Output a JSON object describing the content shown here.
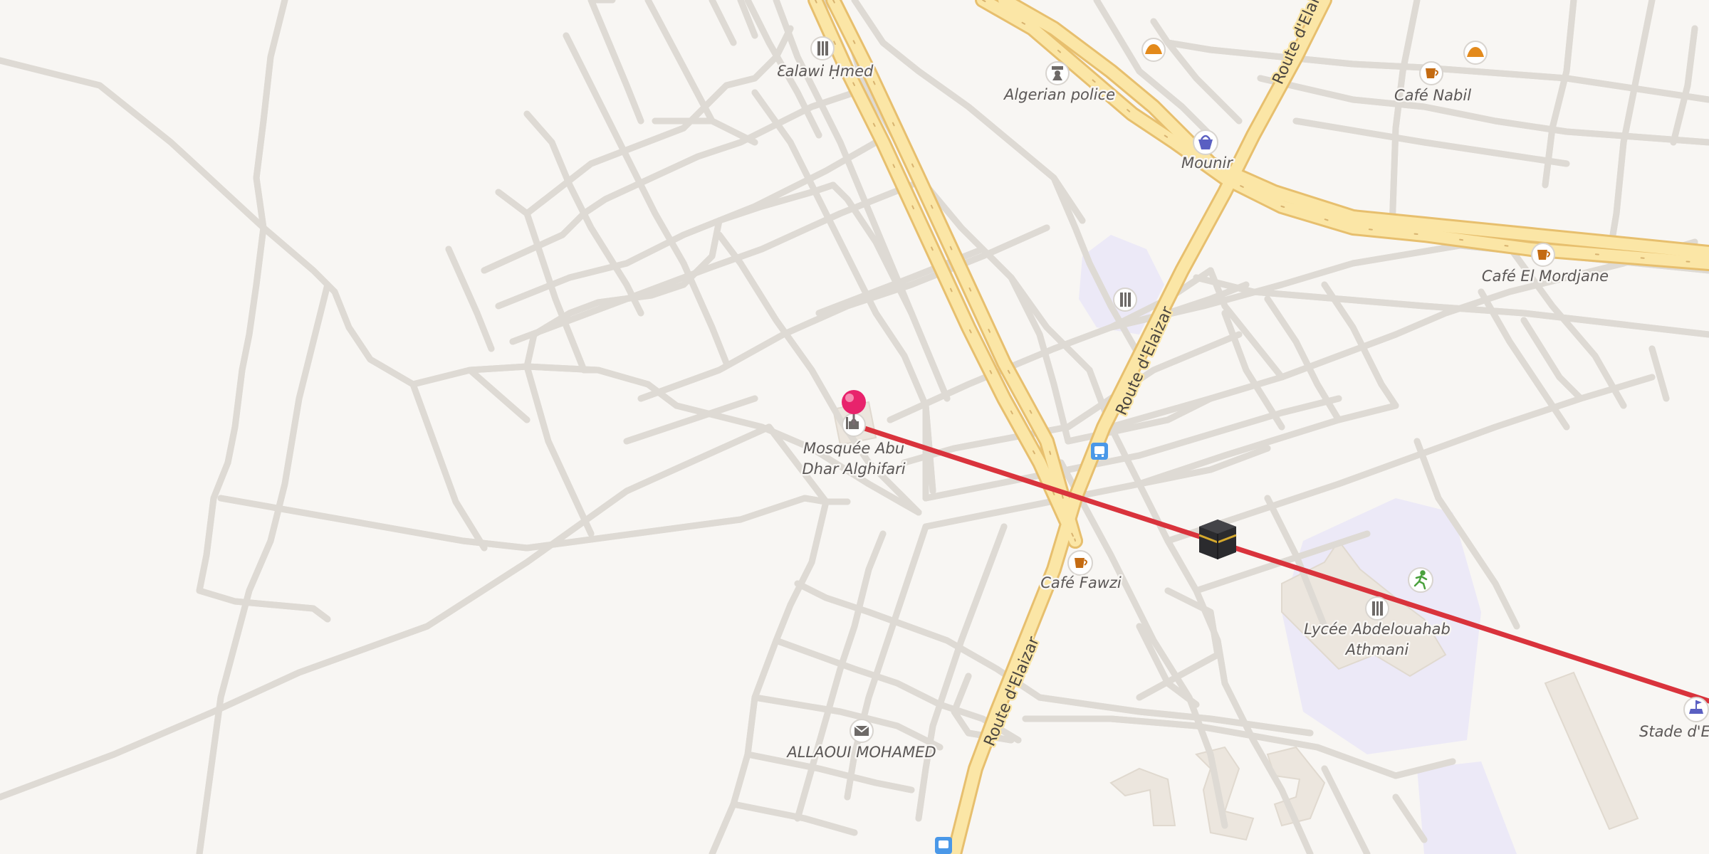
{
  "colors": {
    "background": "#f8f6f3",
    "minor_road": "#ffffff",
    "minor_road_casing": "#dedad4",
    "main_road": "#fbe6a6",
    "main_road_casing": "#e7bf6e",
    "route_line": "#d9333c",
    "pin": "#e8236c",
    "landuse_school": "#ece9f7",
    "building": "#ece6de"
  },
  "roads": {
    "main_label_1": "Route d'Elaizar",
    "main_label_2": "Route d'Elaizar",
    "main_label_3": "Route d'Elaizar"
  },
  "pois": [
    {
      "id": "mosque",
      "label": "Mosquée Abu",
      "label2": "Dhar Alghifari",
      "icon": "mosque-icon"
    },
    {
      "id": "ealawi",
      "label": "Ɛalawi Ḥmed",
      "icon": "hardware-store-icon"
    },
    {
      "id": "police",
      "label": "Algerian police",
      "icon": "police-icon"
    },
    {
      "id": "mounir",
      "label": "Mounir",
      "icon": "shopping-basket-icon"
    },
    {
      "id": "cafe-nabil",
      "label": "Café Nabil",
      "icon": "coffee-cup-icon"
    },
    {
      "id": "cafe-mordjane",
      "label": "Café El Mordjane",
      "icon": "coffee-cup-icon"
    },
    {
      "id": "cafe-fawzi",
      "label": "Café Fawzi",
      "icon": "coffee-cup-icon"
    },
    {
      "id": "lycee",
      "label": "Lycée Abdelouahab",
      "label2": "Athmani",
      "icon": "school-icon"
    },
    {
      "id": "allaoui",
      "label": "ALLAOUI MOHAMED",
      "icon": "mail-icon"
    },
    {
      "id": "stade",
      "label": "Stade d'Er",
      "icon": "stadium-icon"
    }
  ],
  "unlabeled_icons": [
    "bakery-icon",
    "bakery-icon",
    "hardware-store-icon",
    "bus-stop-icon",
    "bus-stop-icon",
    "sports-icon",
    "kaaba-icon"
  ]
}
